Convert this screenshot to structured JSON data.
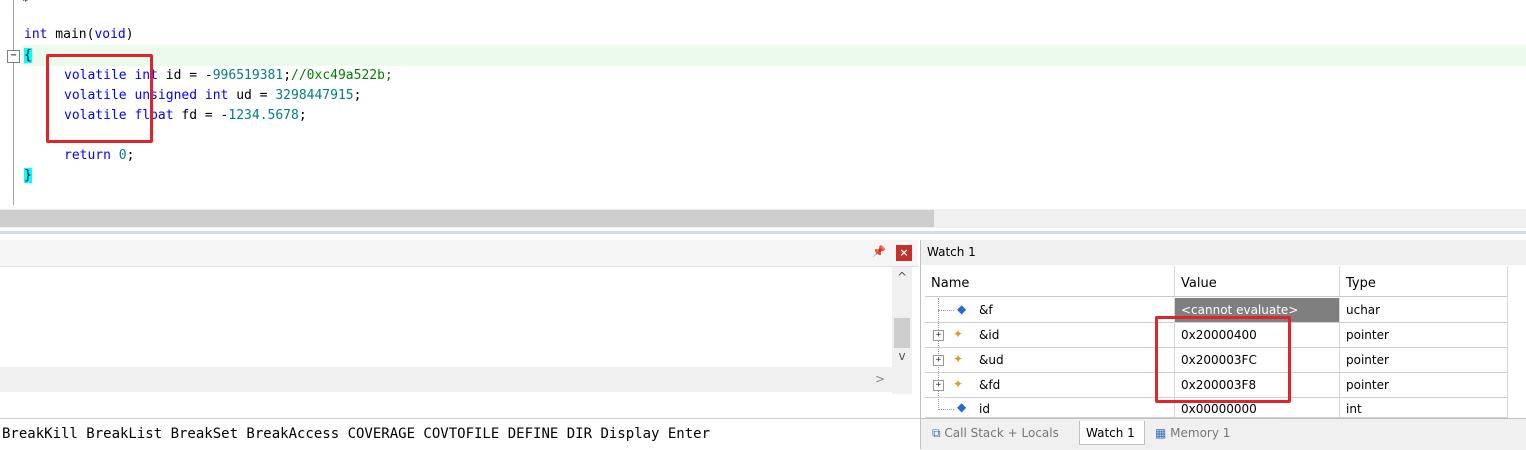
{
  "editor": {
    "top_line": "*",
    "lines": {
      "main_sig_kw": "int",
      "main_sig_rest": " main(",
      "main_sig_void": "void",
      "main_sig_close": ")",
      "open_brace": "{",
      "l1_kw": "volatile",
      "l1_type": "int",
      "l1_rest": " id = -",
      "l1_num": "996519381",
      "l1_semi": ";",
      "l1_cmt": "//0xc49a522b;",
      "l2_kw": "volatile",
      "l2_type": "unsigned int",
      "l2_rest": " ud = ",
      "l2_num": "3298447915",
      "l2_semi": ";",
      "l3_kw": "volatile",
      "l3_type": "float",
      "l3_rest": " fd = -",
      "l3_num": "1234.5678",
      "l3_semi": ";",
      "ret_kw": "return",
      "ret_num": "0",
      "ret_semi": ";",
      "close_brace": "}"
    },
    "fold_symbol": "−"
  },
  "command_panel": {
    "pin_icon": "📌",
    "close_icon": "×",
    "scroll_up": "^",
    "scroll_down": "v",
    "scroll_right": ">",
    "hint_text": "BreakKill BreakList BreakSet BreakAccess COVERAGE COVTOFILE DEFINE DIR Display Enter"
  },
  "watch": {
    "title": "Watch 1",
    "columns": [
      "Name",
      "Value",
      "Type"
    ],
    "rows": [
      {
        "name": "&f",
        "value": "<cannot evaluate>",
        "type": "uchar",
        "expandable": false,
        "icon": "variable-icon"
      },
      {
        "name": "&id",
        "value": "0x20000400",
        "type": "pointer",
        "expandable": true,
        "icon": "pointer-icon"
      },
      {
        "name": "&ud",
        "value": "0x200003FC",
        "type": "pointer",
        "expandable": true,
        "icon": "pointer-icon"
      },
      {
        "name": "&fd",
        "value": "0x200003F8",
        "type": "pointer",
        "expandable": true,
        "icon": "pointer-icon"
      },
      {
        "name": "id",
        "value": "0x00000000",
        "type": "int",
        "expandable": false,
        "icon": "variable-icon"
      }
    ],
    "tabs": [
      "Call Stack + Locals",
      "Watch 1",
      "Memory 1"
    ],
    "active_tab": "Watch 1",
    "expand_symbol": "+"
  },
  "colors": {
    "highlight_box": "#e0242b",
    "current_line": "#ebfaeb",
    "keyword": "#0000ff",
    "number": "#008080",
    "comment": "#008000"
  }
}
